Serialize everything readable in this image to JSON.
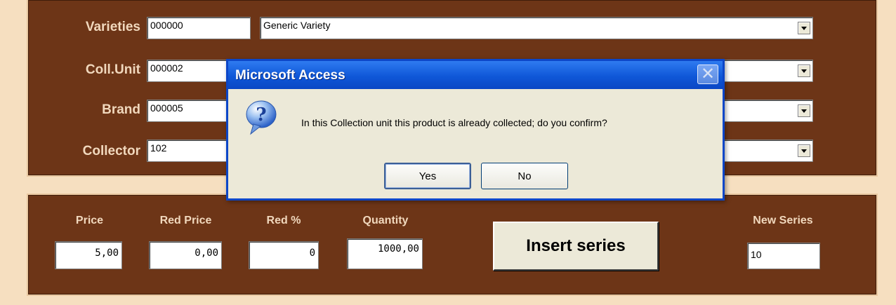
{
  "form": {
    "fields": [
      {
        "label": "Varieties",
        "code": "000000",
        "combo_value": "Generic Variety"
      },
      {
        "label": "Coll.Unit",
        "code": "000002",
        "combo_value": ""
      },
      {
        "label": "Brand",
        "code": "000005",
        "combo_value": ""
      },
      {
        "label": "Collector",
        "code": "102",
        "combo_value": ""
      }
    ],
    "price_label": "Price",
    "price_value": "5,00",
    "red_price_label": "Red Price",
    "red_price_value": "0,00",
    "red_pct_label": "Red %",
    "red_pct_value": "0",
    "quantity_label": "Quantity",
    "quantity_value": "1000,00",
    "insert_label": "Insert series",
    "new_series_label": "New Series",
    "new_series_value": "10"
  },
  "dialog": {
    "title": "Microsoft Access",
    "message": "In this Collection unit this product is already collected; do you confirm?",
    "yes_label": "Yes",
    "no_label": "No",
    "close_glyph": "✕",
    "icon": "question-icon"
  },
  "colors": {
    "panel": "#6d3517",
    "background": "#f6dfc0",
    "titlebar": "#0f57d8"
  }
}
